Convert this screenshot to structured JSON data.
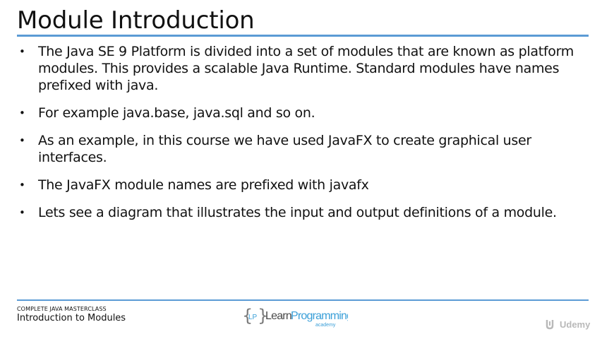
{
  "slide": {
    "title": "Module Introduction",
    "bullets": [
      "The Java SE 9 Platform is divided into a set of modules that are known as platform modules. This provides a scalable Java Runtime. Standard modules have names prefixed with java.",
      "For example java.base, java.sql and so on.",
      "As an example, in this course we have used JavaFX to create graphical user interfaces.",
      "The JavaFX module names are prefixed with javafx",
      "Lets see a diagram that illustrates the input and output definitions of a module."
    ],
    "bullet_symbol": "•",
    "accent_color": "#5b9bd5"
  },
  "footer": {
    "course": "COMPLETE JAVA MASTERCLASS",
    "section": "Introduction to Modules",
    "logo": {
      "icon": "learnprogramming-logo",
      "initials": "LP",
      "word_learn": "Learn",
      "word_programming": "Programming",
      "subtitle": "academy"
    },
    "watermark": {
      "icon": "udemy-logo",
      "text": "Udemy"
    }
  }
}
